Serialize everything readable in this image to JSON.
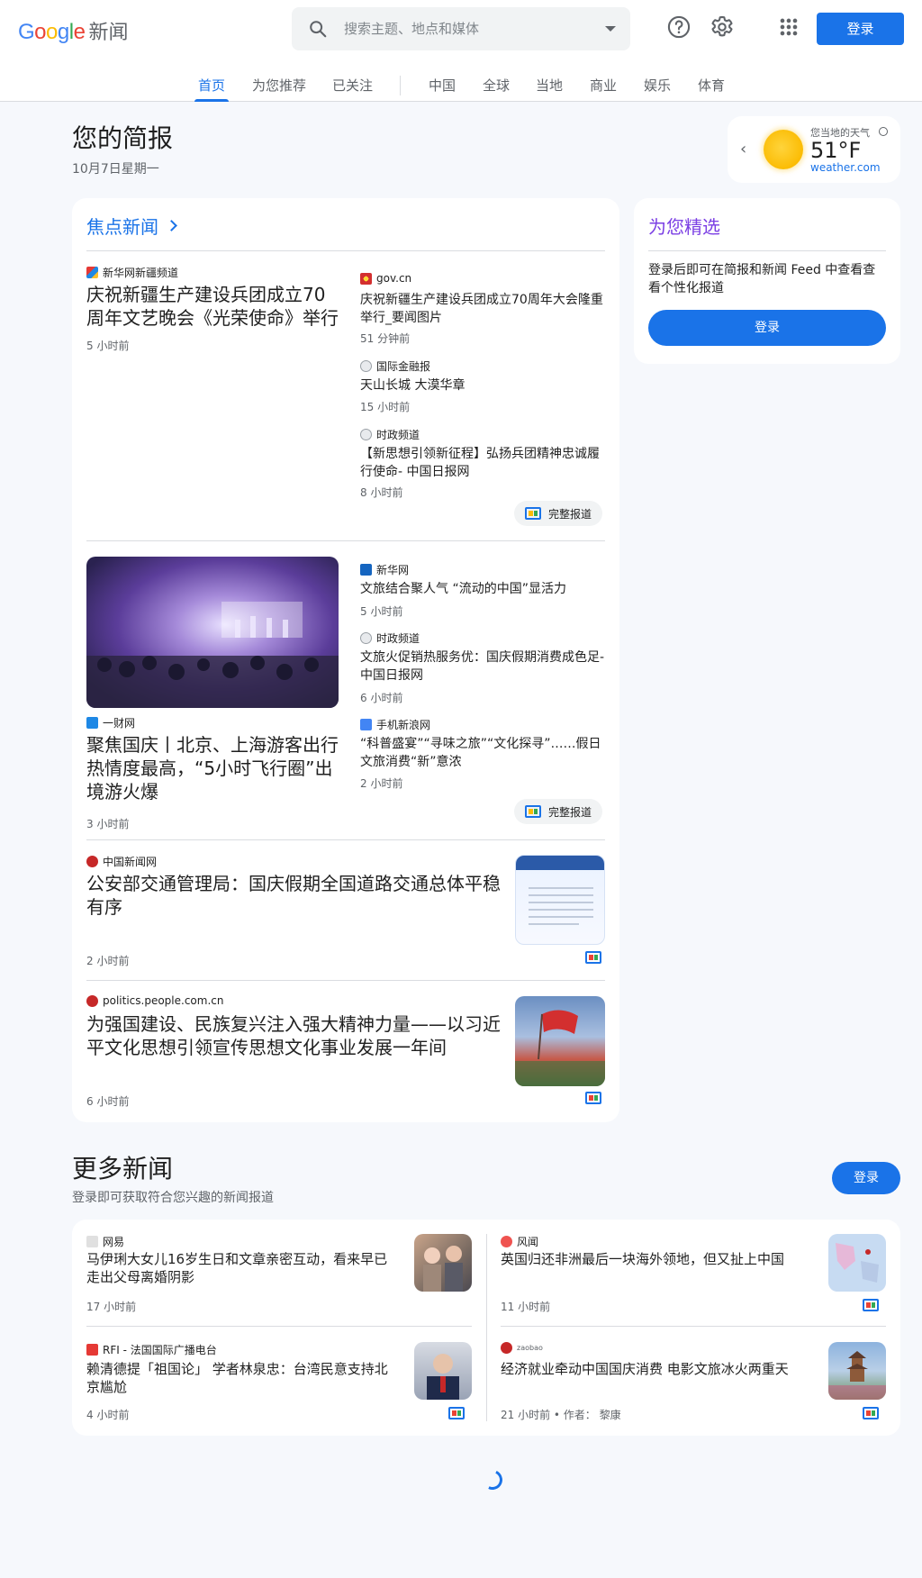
{
  "header": {
    "logo_word": "Google",
    "logo_product": "新闻",
    "search_placeholder": "搜索主题、地点和媒体",
    "login": "登录",
    "icons": [
      "search-icon",
      "help-icon",
      "settings-icon",
      "apps-icon"
    ]
  },
  "nav": {
    "tabs": [
      {
        "label": "首页",
        "active": true
      },
      {
        "label": "为您推荐",
        "active": false
      },
      {
        "label": "已关注",
        "active": false
      },
      {
        "label": "中国",
        "active": false
      },
      {
        "label": "全球",
        "active": false
      },
      {
        "label": "当地",
        "active": false
      },
      {
        "label": "商业",
        "active": false
      },
      {
        "label": "娱乐",
        "active": false
      },
      {
        "label": "体育",
        "active": false
      }
    ]
  },
  "briefing": {
    "title": "您的简报",
    "date": "10月7日星期一"
  },
  "weather": {
    "label": "您当地的天气",
    "temp": "51°F",
    "source": "weather.com"
  },
  "top_stories": {
    "title": "焦点新闻",
    "clusters": [
      {
        "main": {
          "source": "新华网新疆频道",
          "headline": "庆祝新疆生产建设兵团成立70周年文艺晚会《光荣使命》举行",
          "time": "5 小时前"
        },
        "related": [
          {
            "source": "gov.cn",
            "headline": "庆祝新疆生产建设兵团成立70周年大会隆重举行_要闻图片",
            "time": "51 分钟前"
          },
          {
            "source": "国际金融报",
            "headline": "天山长城 大漠华章",
            "time": "15 小时前"
          },
          {
            "source": "时政频道",
            "headline": "【新思想引领新征程】弘扬兵团精神忠诚履行使命- 中国日报网",
            "time": "8 小时前"
          }
        ],
        "full_coverage": "完整报道"
      },
      {
        "main": {
          "source": "一财网",
          "headline": "聚焦国庆丨北京、上海游客出行热情度最高，“5小时飞行圈”出境游火爆",
          "time": "3 小时前"
        },
        "related": [
          {
            "source": "新华网",
            "headline": "文旅结合聚人气 “流动的中国”显活力",
            "time": "5 小时前"
          },
          {
            "source": "时政频道",
            "headline": "文旅火促销热服务优：国庆假期消费成色足- 中国日报网",
            "time": "6 小时前"
          },
          {
            "source": "手机新浪网",
            "headline": "“科普盛宴”“寻味之旅”“文化探寻”……假日文旅消费“新”意浓",
            "time": "2 小时前"
          }
        ],
        "full_coverage": "完整报道"
      }
    ],
    "singles": [
      {
        "source": "中国新闻网",
        "headline": "公安部交通管理局：国庆假期全国道路交通总体平稳有序",
        "time": "2 小时前"
      },
      {
        "source": "politics.people.com.cn",
        "headline": "为强国建设、民族复兴注入强大精神力量——以习近平文化思想引领宣传思想文化事业发展一年间",
        "time": "6 小时前"
      }
    ]
  },
  "picks": {
    "title": "为您精选",
    "text": "登录后即可在简报和新闻 Feed 中查看查看个性化报道",
    "button": "登录"
  },
  "more_news": {
    "title": "更多新闻",
    "subtitle": "登录即可获取符合您兴趣的新闻报道",
    "button": "登录",
    "items": [
      {
        "source": "网易",
        "headline": "马伊琍大女儿16岁生日和文章亲密互动，看来早已走出父母离婚阴影",
        "time": "17 小时前"
      },
      {
        "source": "风闻",
        "headline": "英国归还非洲最后一块海外领地，但又扯上中国",
        "time": "11 小时前"
      },
      {
        "source": "RFI - 法国国际广播电台",
        "headline": "赖清德提「祖国论」 学者林泉忠：台湾民意支持北京尴尬",
        "time": "4 小时前"
      },
      {
        "source": "zaobao",
        "headline": "经济就业牵动中国国庆消费 电影文旅冰火两重天",
        "time": "21 小时前 • 作者：  黎康"
      }
    ]
  },
  "colors": {
    "accent": "#1a73e8",
    "picks_title": "#7b3fe4",
    "background": "#f6f8fc"
  }
}
